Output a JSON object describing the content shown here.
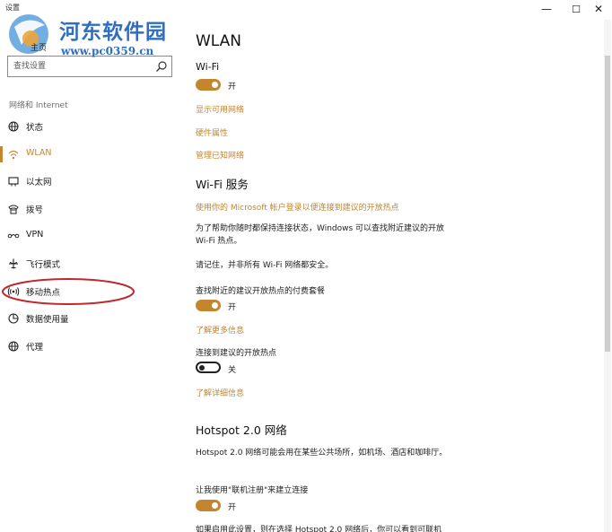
{
  "window": {
    "title": "设置",
    "minimize_glyph": "—",
    "maximize_glyph": "☐",
    "close_glyph": "✕"
  },
  "watermark": {
    "title": "河东软件园",
    "url": "www.pc0359.cn",
    "home_fragment": "主页"
  },
  "search": {
    "placeholder": "查找设置",
    "icon": "search-icon"
  },
  "sidebar": {
    "section_label": "网络和 Internet",
    "items": [
      {
        "label": "状态",
        "icon": "status-globe-icon",
        "active": false
      },
      {
        "label": "WLAN",
        "icon": "wifi-icon",
        "active": true
      },
      {
        "label": "以太网",
        "icon": "ethernet-icon",
        "active": false
      },
      {
        "label": "拨号",
        "icon": "dialup-icon",
        "active": false
      },
      {
        "label": "VPN",
        "icon": "vpn-icon",
        "active": false
      },
      {
        "label": "飞行模式",
        "icon": "airplane-icon",
        "active": false
      },
      {
        "label": "移动热点",
        "icon": "hotspot-icon",
        "active": false,
        "circled": true
      },
      {
        "label": "数据使用量",
        "icon": "data-usage-icon",
        "active": false
      },
      {
        "label": "代理",
        "icon": "proxy-globe-icon",
        "active": false
      }
    ]
  },
  "main": {
    "title": "WLAN",
    "wifi": {
      "heading": "Wi-Fi",
      "toggle_state": "开",
      "toggle_on": true,
      "links": [
        "显示可用网络",
        "硬件属性",
        "管理已知网络"
      ]
    },
    "wifi_service": {
      "heading": "Wi-Fi 服务",
      "sign_in_link": "使用你的 Microsoft 帐户登录以便连接到建议的开放热点",
      "description": "为了帮助你随时都保持连接状态，Windows 可以查找附近建议的开放 Wi-Fi 热点。",
      "reminder": "请记住，并非所有 Wi-Fi 网络都安全。",
      "paid_plans_label": "查找附近的建议开放热点的付费套餐",
      "paid_plans_state": "开",
      "paid_plans_on": true,
      "learn_more_link": "了解更多信息",
      "connect_label": "连接到建议的开放热点",
      "connect_state": "关",
      "connect_on": false,
      "details_link": "了解详细信息"
    },
    "hotspot20": {
      "heading": "Hotspot 2.0 网络",
      "description": "Hotspot 2.0 网络可能会用在某些公共场所，如机场、酒店和咖啡厅。",
      "online_signup_label": "让我使用\"联机注册\"来建立连接",
      "online_signup_state": "开",
      "online_signup_on": true,
      "cutoff_text": "如果启用此设置，则在选择 Hotspot 2.0 网络后，你可以看到可联机"
    }
  },
  "colors": {
    "accent": "#c3862f",
    "annotation_ellipse": "#c0282d",
    "watermark_blue": "#2f6fc2"
  }
}
